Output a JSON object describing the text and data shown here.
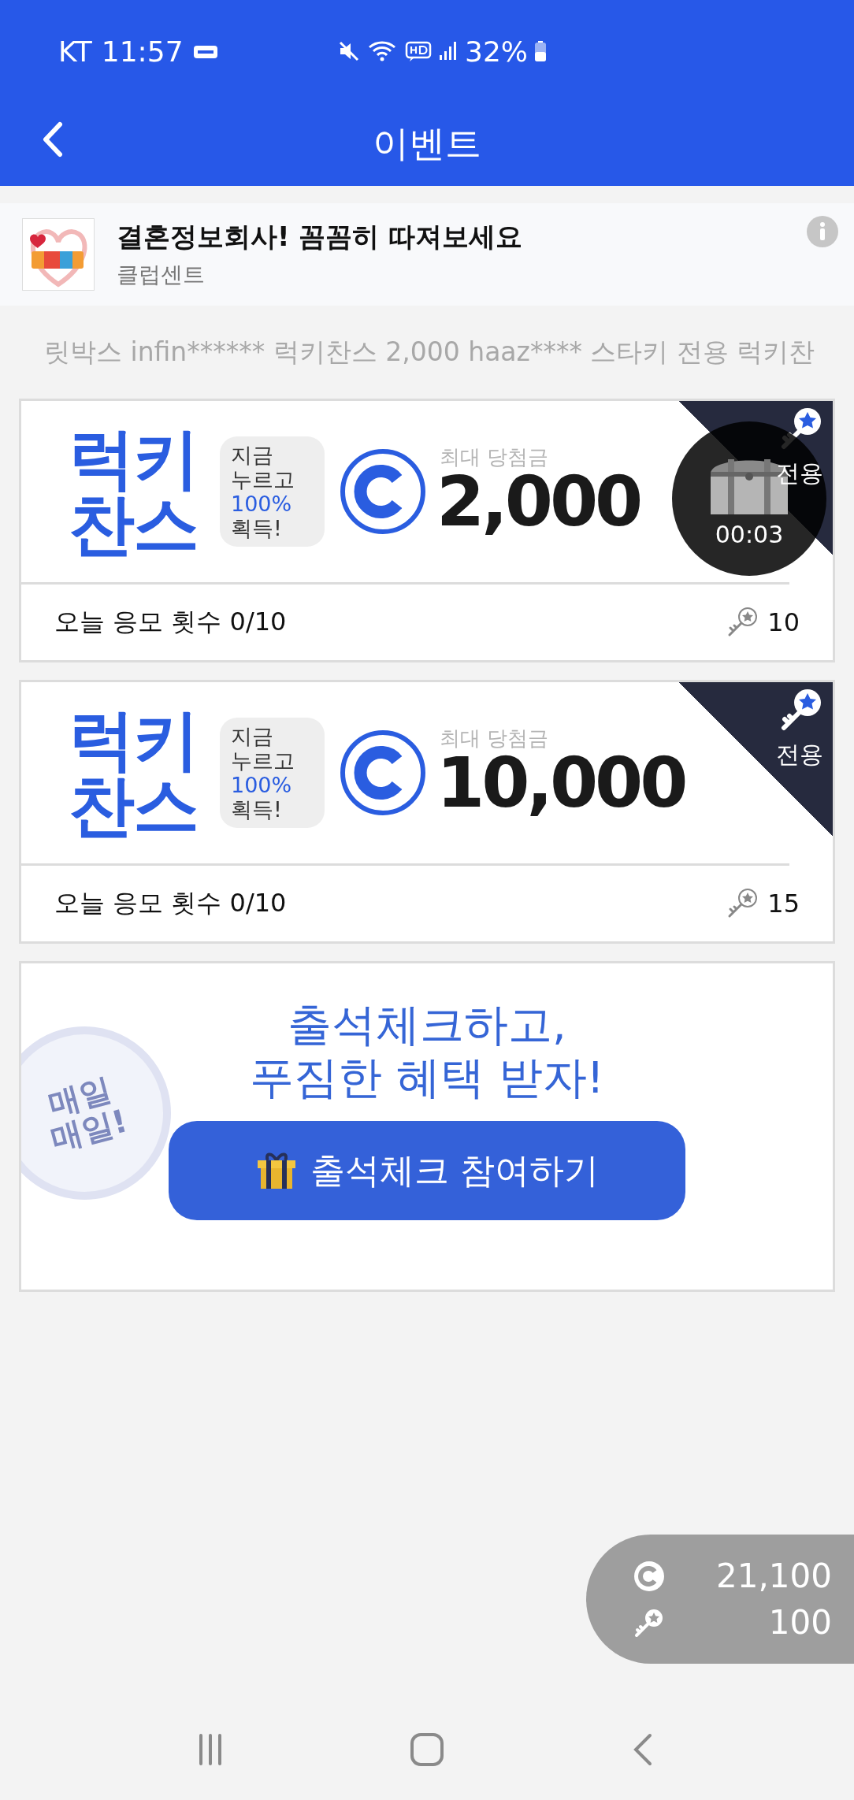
{
  "status_bar": {
    "carrier": "KT",
    "time": "11:57",
    "battery": "32%"
  },
  "header": {
    "title": "이벤트"
  },
  "ad": {
    "title": "결혼정보회사! 꼼꼼히 따져보세요",
    "advertiser": "클럽센트"
  },
  "ticker": {
    "text": "릿박스 infin******  럭키찬스 2,000 haaz****  스타키 전용 럭키찬"
  },
  "lucky_cards": [
    {
      "title_lines": [
        "럭키",
        "찬스"
      ],
      "bubble_lines": [
        {
          "text": "지금",
          "highlight": false
        },
        {
          "text": "누르고",
          "highlight": false
        },
        {
          "text": "100%",
          "highlight": true
        },
        {
          "text": "획득!",
          "highlight": false
        }
      ],
      "max_label": "최대 당첨금",
      "amount": "2,000",
      "badge": "전용",
      "timer": "00:03",
      "entries": "오늘 응모 횟수 0/10",
      "keys": "10"
    },
    {
      "title_lines": [
        "럭키",
        "찬스"
      ],
      "bubble_lines": [
        {
          "text": "지금",
          "highlight": false
        },
        {
          "text": "누르고",
          "highlight": false
        },
        {
          "text": "100%",
          "highlight": true
        },
        {
          "text": "획득!",
          "highlight": false
        }
      ],
      "max_label": "최대 당첨금",
      "amount": "10,000",
      "badge": "전용",
      "entries": "오늘 응모 횟수 0/10",
      "keys": "15"
    }
  ],
  "attendance": {
    "stamp_lines": [
      "매일",
      "매일!"
    ],
    "headline_lines": [
      "출석체크하고,",
      "푸짐한 혜택 받자!"
    ],
    "button": "출석체크 참여하기"
  },
  "balance": {
    "coins": "21,100",
    "keys": "100"
  }
}
